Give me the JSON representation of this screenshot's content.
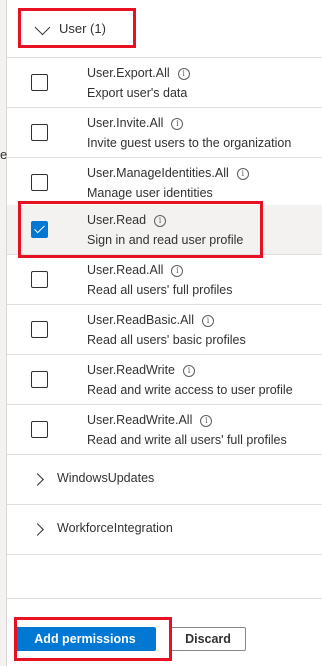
{
  "left_stub": "e",
  "group": {
    "title": "User (1)"
  },
  "permissions": [
    {
      "name": "User.Export.All",
      "description": "Export user's data",
      "checked": false
    },
    {
      "name": "User.Invite.All",
      "description": "Invite guest users to the organization",
      "checked": false
    },
    {
      "name": "User.ManageIdentities.All",
      "description": "Manage user identities",
      "checked": false
    },
    {
      "name": "User.Read",
      "description": "Sign in and read user profile",
      "checked": true
    },
    {
      "name": "User.Read.All",
      "description": "Read all users' full profiles",
      "checked": false
    },
    {
      "name": "User.ReadBasic.All",
      "description": "Read all users' basic profiles",
      "checked": false
    },
    {
      "name": "User.ReadWrite",
      "description": "Read and write access to user profile",
      "checked": false
    },
    {
      "name": "User.ReadWrite.All",
      "description": "Read and write all users' full profiles",
      "checked": false
    }
  ],
  "collapsed_groups": [
    {
      "title": "WindowsUpdates"
    },
    {
      "title": "WorkforceIntegration"
    }
  ],
  "footer": {
    "add_label": "Add permissions",
    "discard_label": "Discard"
  },
  "info_glyph": "i",
  "colors": {
    "accent": "#0078d4",
    "highlight": "#e81123"
  }
}
